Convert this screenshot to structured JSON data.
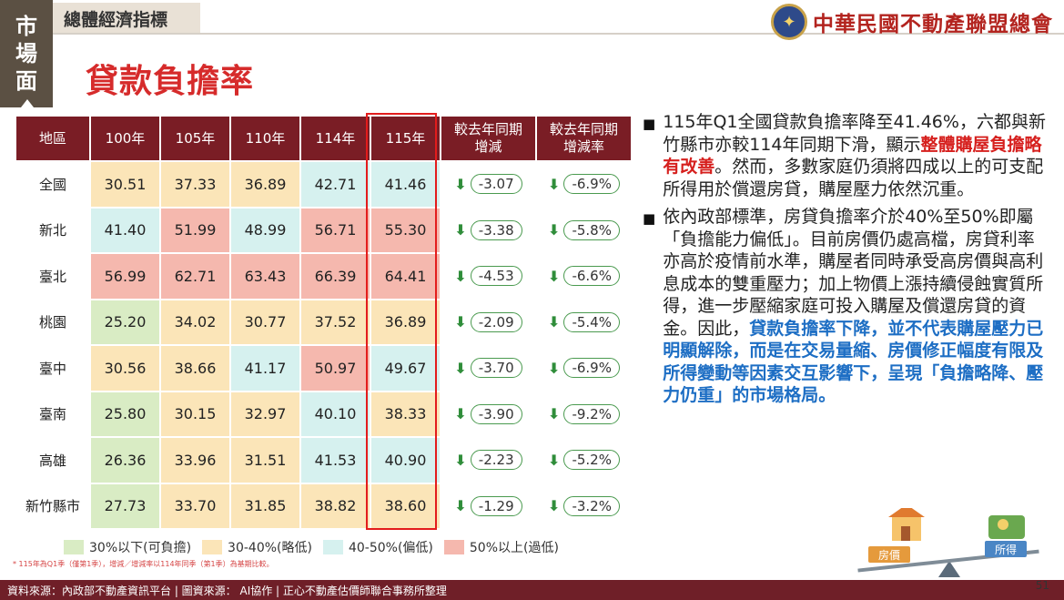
{
  "side_tab": [
    "市",
    "場",
    "面"
  ],
  "section_tag": "總體經濟指標",
  "page_title": "貸款負擔率",
  "org_name": "中華民國不動產聯盟總會",
  "table": {
    "headers": [
      "地區",
      "100年",
      "105年",
      "110年",
      "114年",
      "115年",
      "較去年同期\n增減",
      "較去年同期\n增減率"
    ],
    "rows": [
      {
        "region": "全國",
        "values": [
          "30.51",
          "37.33",
          "36.89",
          "42.71",
          "41.46"
        ],
        "colors": [
          "yellow",
          "yellow",
          "yellow",
          "cyan",
          "cyan"
        ],
        "chg": "-3.07",
        "rate": "-6.9%"
      },
      {
        "region": "新北",
        "values": [
          "41.40",
          "51.99",
          "48.99",
          "56.71",
          "55.30"
        ],
        "colors": [
          "cyan",
          "red",
          "cyan",
          "red",
          "red"
        ],
        "chg": "-3.38",
        "rate": "-5.8%"
      },
      {
        "region": "臺北",
        "values": [
          "56.99",
          "62.71",
          "63.43",
          "66.39",
          "64.41"
        ],
        "colors": [
          "red",
          "red",
          "red",
          "red",
          "red"
        ],
        "chg": "-4.53",
        "rate": "-6.6%"
      },
      {
        "region": "桃園",
        "values": [
          "25.20",
          "34.02",
          "30.77",
          "37.52",
          "36.89"
        ],
        "colors": [
          "green",
          "yellow",
          "yellow",
          "yellow",
          "yellow"
        ],
        "chg": "-2.09",
        "rate": "-5.4%"
      },
      {
        "region": "臺中",
        "values": [
          "30.56",
          "38.66",
          "41.17",
          "50.97",
          "49.67"
        ],
        "colors": [
          "yellow",
          "yellow",
          "cyan",
          "red",
          "cyan"
        ],
        "chg": "-3.70",
        "rate": "-6.9%"
      },
      {
        "region": "臺南",
        "values": [
          "25.80",
          "30.15",
          "32.97",
          "40.10",
          "38.33"
        ],
        "colors": [
          "green",
          "yellow",
          "yellow",
          "cyan",
          "yellow"
        ],
        "chg": "-3.90",
        "rate": "-9.2%"
      },
      {
        "region": "高雄",
        "values": [
          "26.36",
          "33.96",
          "31.51",
          "41.53",
          "40.90"
        ],
        "colors": [
          "green",
          "yellow",
          "yellow",
          "cyan",
          "cyan"
        ],
        "chg": "-2.23",
        "rate": "-5.2%"
      },
      {
        "region": "新竹縣市",
        "values": [
          "27.73",
          "33.70",
          "31.85",
          "38.82",
          "38.60"
        ],
        "colors": [
          "green",
          "yellow",
          "yellow",
          "yellow",
          "yellow"
        ],
        "chg": "-1.29",
        "rate": "-3.2%"
      }
    ]
  },
  "legend": [
    {
      "label": "30%以下(可負擔)",
      "color": "#d9ecc4"
    },
    {
      "label": "30-40%(略低)",
      "color": "#fbe5b8"
    },
    {
      "label": "40-50%(偏低)",
      "color": "#d6f1ef"
    },
    {
      "label": "50%以上(過低)",
      "color": "#f5b8ae"
    }
  ],
  "footnote": "* 115年為Q1季（僅第1季），增減／增減率以114年同季（第1季）為基期比較。",
  "bullets": {
    "b1_plain1": "115年Q1全國貸款負擔率降至41.46%，六都與新竹縣市亦較114年同期下滑，顯示",
    "b1_red": "整體購屋負擔略有改善",
    "b1_plain2": "。然而，多數家庭仍須將四成以上的可支配所得用於償還房貸，購屋壓力依然沉重。",
    "b2_plain": "依內政部標準，房貸負擔率介於40%至50%即屬「負擔能力偏低」。目前房價仍處高檔，房貸利率亦高於疫情前水準，購屋者同時承受高房價與高利息成本的雙重壓力；加上物價上漲持續侵蝕實質所得，進一步壓縮家庭可投入購屋及償還房貸的資金。因此，",
    "b2_blue": "貸款負擔率下降，並不代表購屋壓力已明顯解除，而是在交易量縮、房價修正幅度有限及所得變動等因素交互影響下，呈現「負擔略降、壓力仍重」的市場格局。"
  },
  "illus": {
    "left_label": "房價",
    "right_label": "所得"
  },
  "footer": "資料來源：內政部不動產資訊平台 | 圖資來源： AI協作 | 正心不動產估價師聯合事務所整理",
  "page_number": "51",
  "colors": {
    "green": "#d9ecc4",
    "yellow": "#fbe5b8",
    "cyan": "#d6f1ef",
    "red": "#f5b8ae",
    "header": "#7a1d25",
    "title_red": "#d62b2b"
  }
}
